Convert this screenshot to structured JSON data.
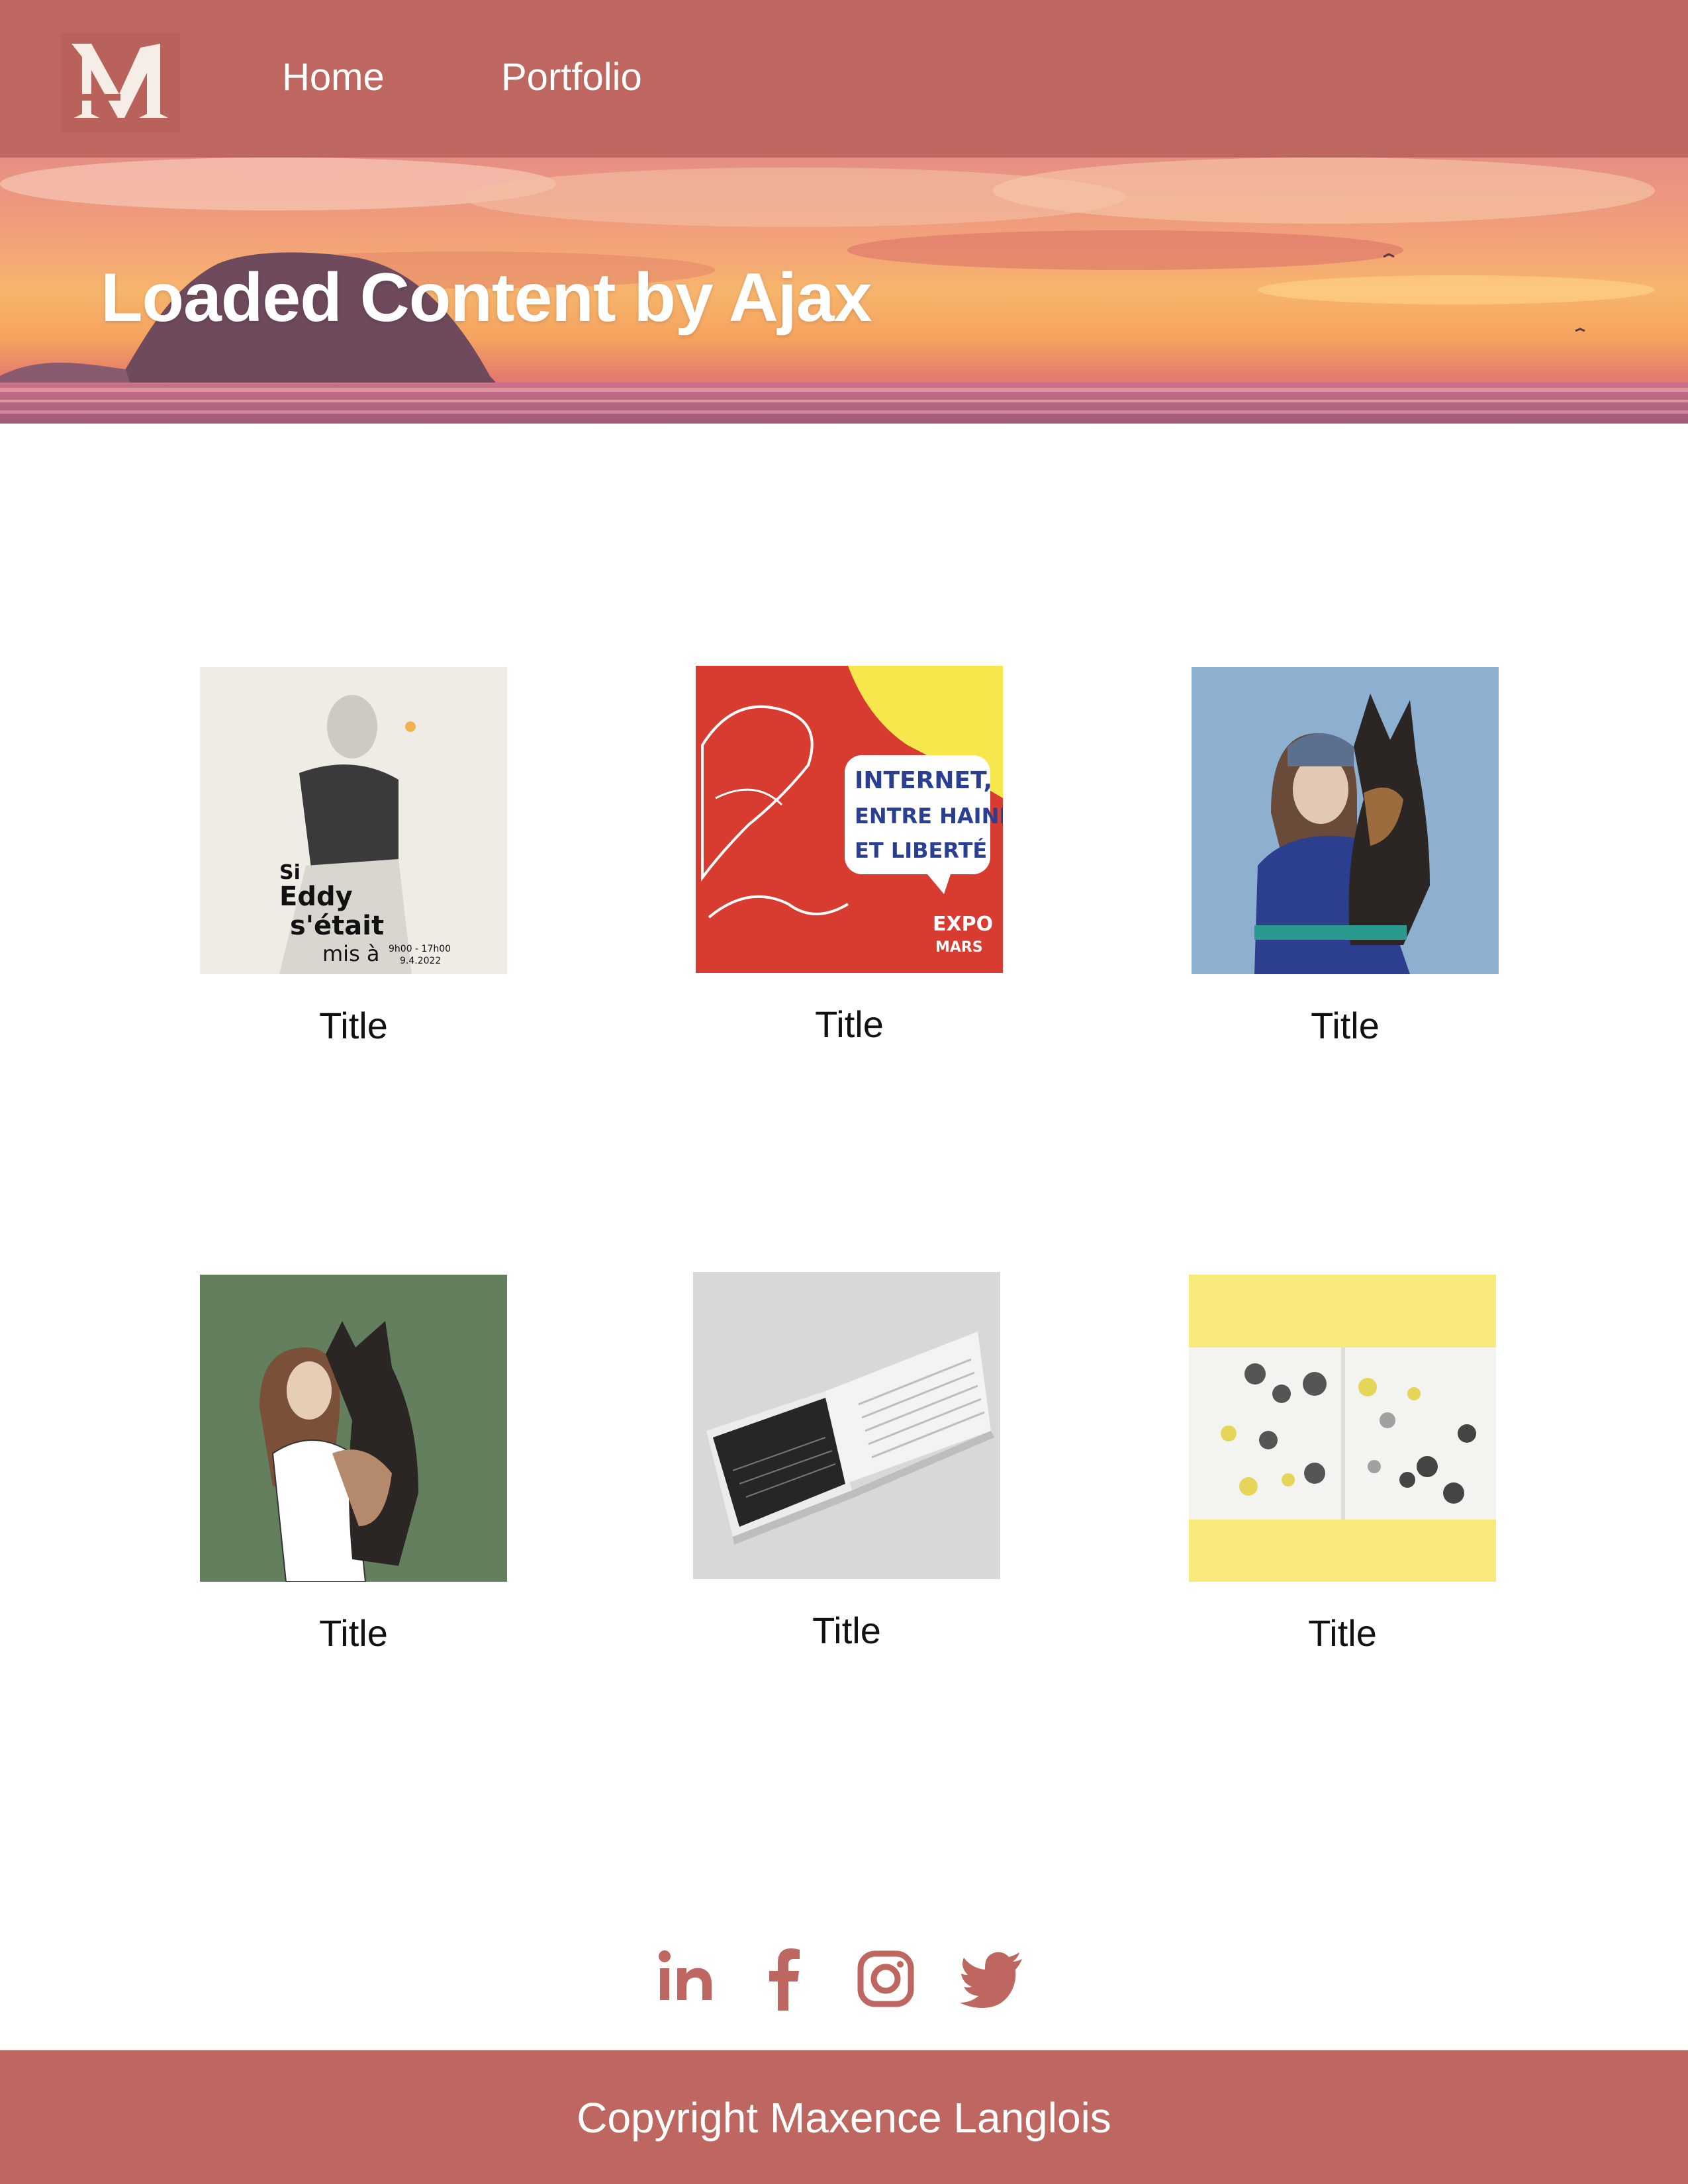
{
  "header": {
    "logo_label": "M",
    "nav": [
      {
        "label": "Home"
      },
      {
        "label": "Portfolio"
      }
    ]
  },
  "hero": {
    "title": "Loaded Content by Ajax"
  },
  "grid": {
    "items": [
      {
        "title": "Title",
        "poster_lines": [
          "Si",
          "Eddy",
          "s'était",
          "mis à",
          "9h00 - 17h00",
          "9.4.2022"
        ]
      },
      {
        "title": "Title",
        "poster_lines": [
          "INTERNET,",
          "ENTRE HAINE",
          "ET LIBERTÉ",
          "EXPO",
          "MARS"
        ]
      },
      {
        "title": "Title"
      },
      {
        "title": "Title"
      },
      {
        "title": "Title"
      },
      {
        "title": "Title"
      }
    ]
  },
  "social": {
    "icons": [
      "linkedin-icon",
      "facebook-icon",
      "instagram-icon",
      "twitter-icon"
    ]
  },
  "footer": {
    "copyright": "Copyright Maxence Langlois"
  },
  "colors": {
    "brand": "#bd6760",
    "text": "#111111",
    "background": "#ffffff"
  }
}
